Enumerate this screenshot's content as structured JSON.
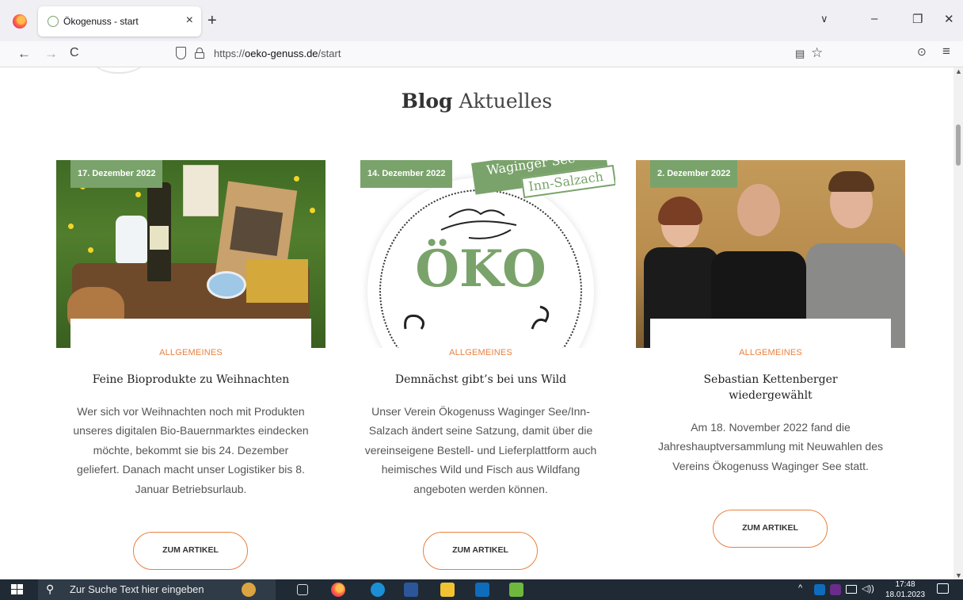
{
  "browser": {
    "tab_title": "Ökogenuss - start",
    "tab_close": "×",
    "new_tab": "+",
    "tab_list": "∨",
    "win_min": "–",
    "win_restore": "❐",
    "win_close": "✕",
    "back": "←",
    "forward": "→",
    "reload": "C",
    "url_prefix": "https://",
    "url_domain": "oeko-genuss.de",
    "url_path": "/start",
    "reader": "▤",
    "bookmark": "☆",
    "pocket": "⊙",
    "menu": "≡"
  },
  "page": {
    "heading_bold": "Blog",
    "heading_light": "Aktuelles",
    "posts": [
      {
        "date": "17. Dezember 2022",
        "category": "ALLGEMEINES",
        "title": "Feine Bioprodukte zu Weihnachten",
        "text": "Wer sich vor Weihnachten noch mit Produkten unseres digitalen Bio-Bauernmarktes eindecken möchte, bekommt sie bis 24. Dezember geliefert. Danach macht unser Logistiker bis 8. Januar Betriebsurlaub.",
        "button": "ZUM ARTIKEL"
      },
      {
        "date": "14. Dezember 2022",
        "category": "ALLGEMEINES",
        "title": "Demnächst gibt’s bei uns Wild",
        "text": "Unser Verein Ökogenuss Waginger See/Inn-Salzach ändert seine Satzung, damit über die vereinseigene Bestell- und Lieferplattform auch heimisches Wild und Fisch aus Wildfang angeboten werden können.",
        "button": "ZUM ARTIKEL",
        "image_logo_text": "ÖKO",
        "image_banner_1": "Waginger See",
        "image_banner_2": "Inn-Salzach"
      },
      {
        "date": "2. Dezember 2022",
        "category": "ALLGEMEINES",
        "title": "Sebastian Kettenberger wiedergewählt",
        "text": "Am 18. November 2022 fand die Jahreshauptversammlung mit Neuwahlen des Vereins Ökogenuss Waginger See statt.",
        "button": "ZUM ARTIKEL"
      }
    ]
  },
  "scrollbar": {
    "up": "▲",
    "down": "▼"
  },
  "taskbar": {
    "search_icon": "⚲",
    "search_placeholder": "Zur Suche Text hier eingeben",
    "tray_chevron": "^",
    "tray_volume": "◁))",
    "time": "17:48",
    "date": "18.01.2023"
  },
  "colors": {
    "accent_orange": "#e9803f",
    "accent_green": "#7aa36b",
    "taskbar": "#1f2a35"
  }
}
